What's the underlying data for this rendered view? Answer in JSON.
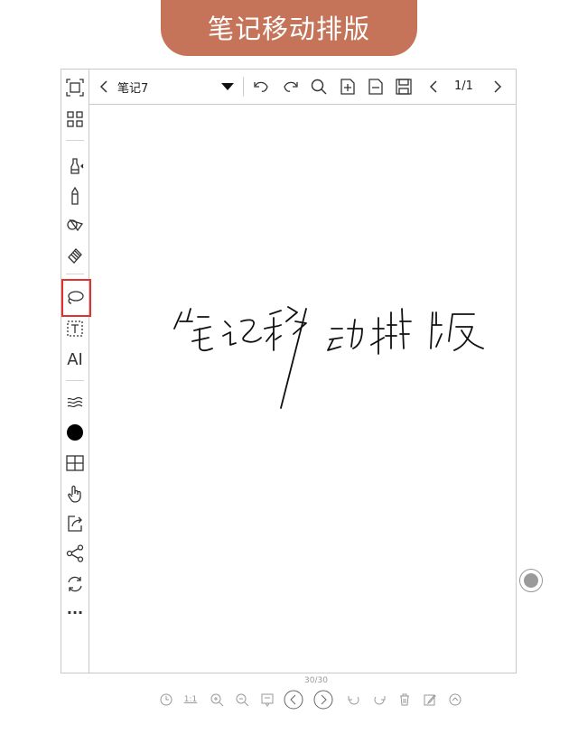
{
  "banner": {
    "title": "笔记移动排版"
  },
  "topbar": {
    "back_icon": "chevron-left-icon",
    "note_title": "笔记7",
    "dropdown_icon": "triangle-down-icon",
    "page_indicator": "1/1"
  },
  "sidebar": {
    "tools": [
      "fullscreen-icon",
      "grid-icon",
      "pen-icon",
      "pencil-icon",
      "shape-icon",
      "eraser-icon",
      "lasso-icon",
      "text-box-icon",
      "ai-icon",
      "stroke-width-icon",
      "color-icon",
      "table-icon",
      "hand-icon",
      "export-icon",
      "share-icon",
      "sync-icon",
      "more-icon"
    ],
    "ai_label": "AI",
    "more_label": "···"
  },
  "canvas": {
    "handwriting_text": "笔记移动排版",
    "page_count": "30/30",
    "bottom_tools": [
      "clock-icon",
      "ratio-1-1-icon",
      "zoom-in-icon",
      "zoom-out-icon",
      "bookmark-icon",
      "prev-page-icon",
      "next-page-icon",
      "undo-icon",
      "redo-icon",
      "delete-icon",
      "edit-icon",
      "up-icon"
    ],
    "ratio_label": "1:1"
  },
  "colors": {
    "banner": "#c57459",
    "highlight": "#e0332f",
    "arrow": "#e0332f"
  }
}
